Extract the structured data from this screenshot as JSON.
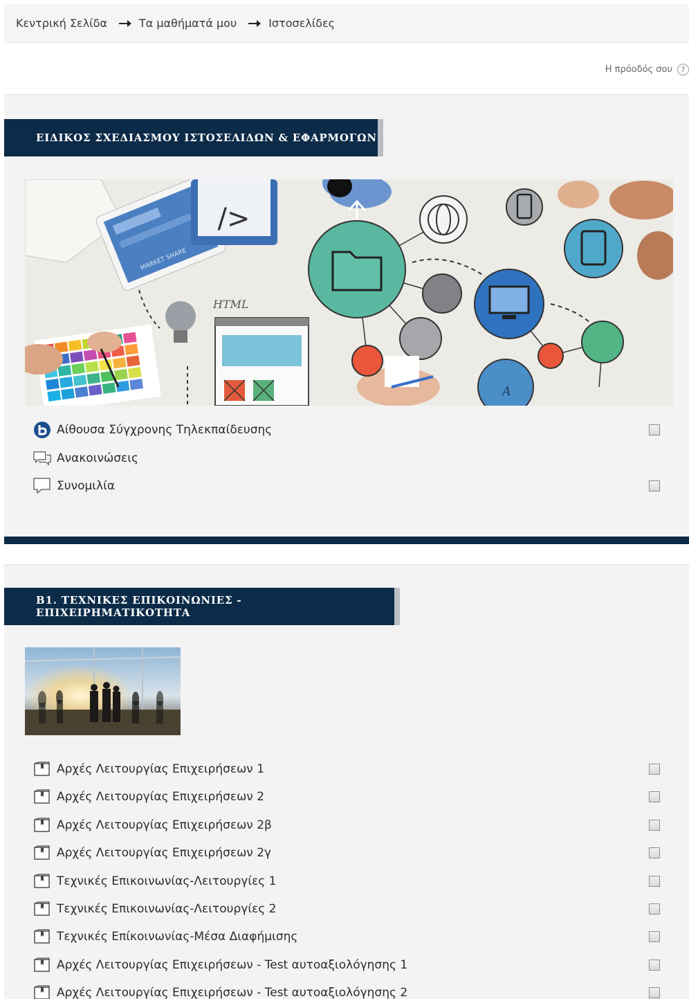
{
  "breadcrumb": {
    "items": [
      "Κεντρική Σελίδα",
      "Τα μαθήματά μου",
      "Ιστοσελίδες"
    ]
  },
  "progress": {
    "label": "Η πρόοδός σου",
    "help": "?"
  },
  "sections": [
    {
      "title": "ΕΙΔΙΚΟΣ ΣΧΕΔΙΑΣΜΟΥ ΙΣΤΟΣΕΛΙΔΩΝ & ΕΦΑΡΜΟΓΩΝ",
      "banner": {
        "html_label": "HTML",
        "tablet_text": "MARKET SHARE",
        "bubble_letter": "A"
      },
      "activities": [
        {
          "label": "Αίθουσα Σύγχρονης Τηλεκπαίδευσης",
          "icon": "bigbluebutton-icon",
          "checkbox": true
        },
        {
          "label": "Ανακοινώσεις",
          "icon": "forum-icon",
          "checkbox": false
        },
        {
          "label": "Συνομιλία",
          "icon": "chat-icon",
          "checkbox": true
        }
      ]
    },
    {
      "title": "Β1. ΤΕΧΝΙΚΕΣ ΕΠΙΚΟΙΝΩΝΙΕΣ - ΕΠΙΧΕΙΡΗΜΑΤΙΚΟΤΗΤΑ",
      "activities": [
        {
          "label": "Αρχές Λειτουργίας Επιχειρήσεων 1",
          "icon": "book-icon",
          "checkbox": true
        },
        {
          "label": "Αρχές Λειτουργίας Επιχειρήσεων 2",
          "icon": "book-icon",
          "checkbox": true
        },
        {
          "label": "Αρχές Λειτουργίας Επιχειρήσεων 2β",
          "icon": "book-icon",
          "checkbox": true
        },
        {
          "label": "Αρχές Λειτουργίας Επιχειρήσεων 2γ",
          "icon": "book-icon",
          "checkbox": true
        },
        {
          "label": "Τεχνικές Επικοινωνίας-Λειτουργίες 1",
          "icon": "book-icon",
          "checkbox": true
        },
        {
          "label": "Τεχνικές Επικοινωνίας-Λειτουργίες 2",
          "icon": "book-icon",
          "checkbox": true
        },
        {
          "label": "Τεχνικές Επίκοινωνίας-Μέσα Διαφήμισης",
          "icon": "book-icon",
          "checkbox": true
        },
        {
          "label": "Αρχές Λειτουργίας Επιχειρήσεων - Test αυτοαξιολόγησης 1",
          "icon": "book-icon",
          "checkbox": true
        },
        {
          "label": "Αρχές Λειτουργίας Επιχειρήσεων - Test αυτοαξιολόγησης 2",
          "icon": "book-icon",
          "checkbox": true
        }
      ]
    }
  ],
  "colors": {
    "title_bg": "#0c2b48",
    "section_bg": "#f3f3f3"
  }
}
